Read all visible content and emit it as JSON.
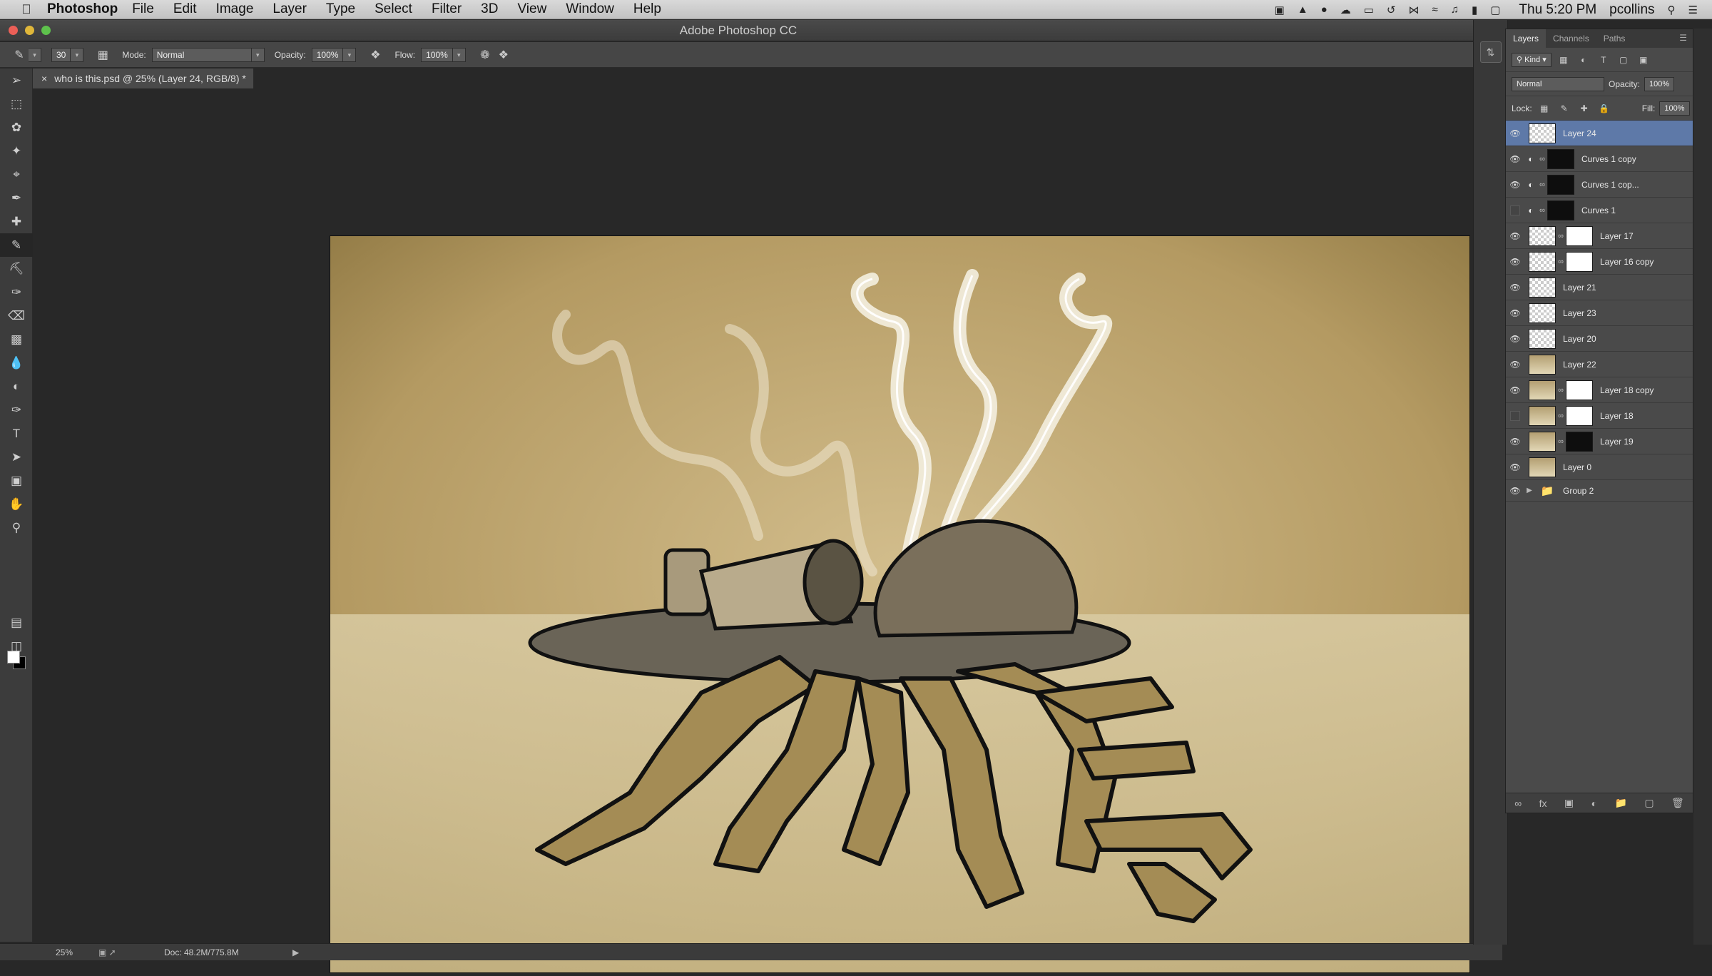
{
  "menubar": {
    "app_name": "Photoshop",
    "items": [
      "File",
      "Edit",
      "Image",
      "Layer",
      "Type",
      "Select",
      "Filter",
      "3D",
      "View",
      "Window",
      "Help"
    ],
    "clock": "Thu 5:20 PM",
    "user": "pcollins"
  },
  "window": {
    "title": "Adobe Photoshop CC"
  },
  "options": {
    "brush_size": "30",
    "mode_label": "Mode:",
    "mode_value": "Normal",
    "opacity_label": "Opacity:",
    "opacity_value": "100%",
    "flow_label": "Flow:",
    "flow_value": "100%"
  },
  "document": {
    "tab_title": "who is this.psd @ 25% (Layer 24, RGB/8) *"
  },
  "status": {
    "zoom": "25%",
    "doc_size": "Doc: 48.2M/775.8M"
  },
  "panel": {
    "tabs": [
      "Layers",
      "Channels",
      "Paths"
    ],
    "filter_kind": "Kind",
    "blend_mode": "Normal",
    "opacity_label": "Opacity:",
    "opacity_value": "100%",
    "lock_label": "Lock:",
    "fill_label": "Fill:",
    "fill_value": "100%"
  },
  "layers": [
    {
      "name": "Layer 24",
      "visible": true,
      "selected": true,
      "thumb": "checker"
    },
    {
      "name": "Curves 1 copy",
      "visible": true,
      "adjustment": true,
      "mask": "black"
    },
    {
      "name": "Curves 1 cop...",
      "visible": true,
      "adjustment": true,
      "mask": "black"
    },
    {
      "name": "Curves 1",
      "visible": false,
      "adjustment": true,
      "mask": "black"
    },
    {
      "name": "Layer 17",
      "visible": true,
      "thumb": "checker",
      "mask": "white"
    },
    {
      "name": "Layer 16 copy",
      "visible": true,
      "thumb": "checker",
      "mask": "white"
    },
    {
      "name": "Layer 21",
      "visible": true,
      "thumb": "checker"
    },
    {
      "name": "Layer 23",
      "visible": true,
      "thumb": "checker"
    },
    {
      "name": "Layer 20",
      "visible": true,
      "thumb": "checker"
    },
    {
      "name": "Layer 22",
      "visible": true,
      "thumb": "tan"
    },
    {
      "name": "Layer 18 copy",
      "visible": true,
      "thumb": "tan",
      "mask": "white"
    },
    {
      "name": "Layer 18",
      "visible": false,
      "thumb": "tan",
      "mask": "white"
    },
    {
      "name": "Layer 19",
      "visible": true,
      "thumb": "tan",
      "mask": "black"
    },
    {
      "name": "Layer 0",
      "visible": true,
      "thumb": "tan"
    },
    {
      "name": "Group 2",
      "visible": true,
      "group": true
    }
  ],
  "colors": {
    "selected_layer": "#5e79a8",
    "panel_bg": "#4a4a4a",
    "canvas_paper": "#c2ab7a"
  }
}
